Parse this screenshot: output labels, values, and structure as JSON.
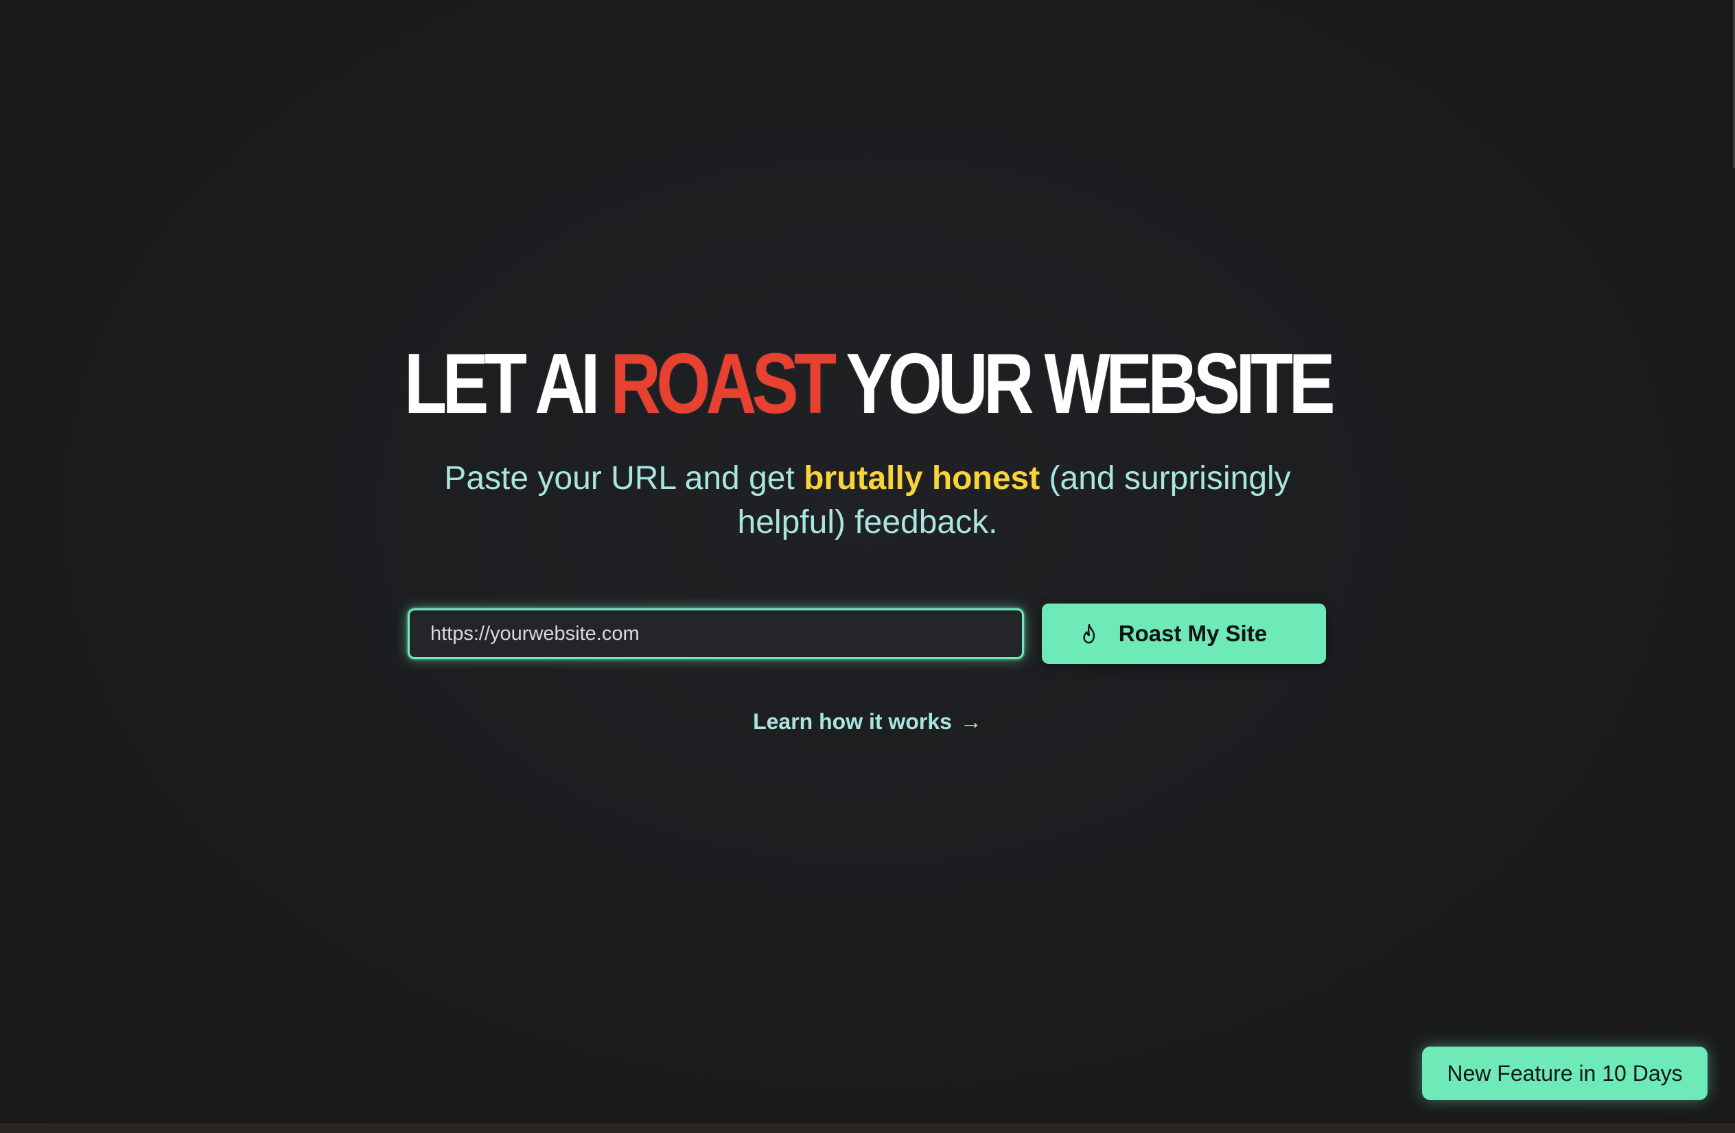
{
  "headline": {
    "part1": "LET AI ",
    "highlight": "ROAST",
    "part2": " YOUR WEBSITE"
  },
  "subtitle": {
    "before": "Paste your URL and get ",
    "highlight": "brutally honest",
    "after": " (and surprisingly helpful) feedback."
  },
  "form": {
    "url_placeholder": "https://yourwebsite.com",
    "button_label": "Roast My Site",
    "button_icon": "flame-icon"
  },
  "learn_link": {
    "label": "Learn how it works",
    "icon": "arrow-right-icon",
    "arrow": "→"
  },
  "badge": {
    "label": "New Feature in 10 Days"
  },
  "colors": {
    "background": "#1b1c1e",
    "accent": "#6ee9b8",
    "roast_red": "#e8412f",
    "highlight_yellow": "#f8d43a",
    "subtitle_teal": "#a9e6df"
  }
}
